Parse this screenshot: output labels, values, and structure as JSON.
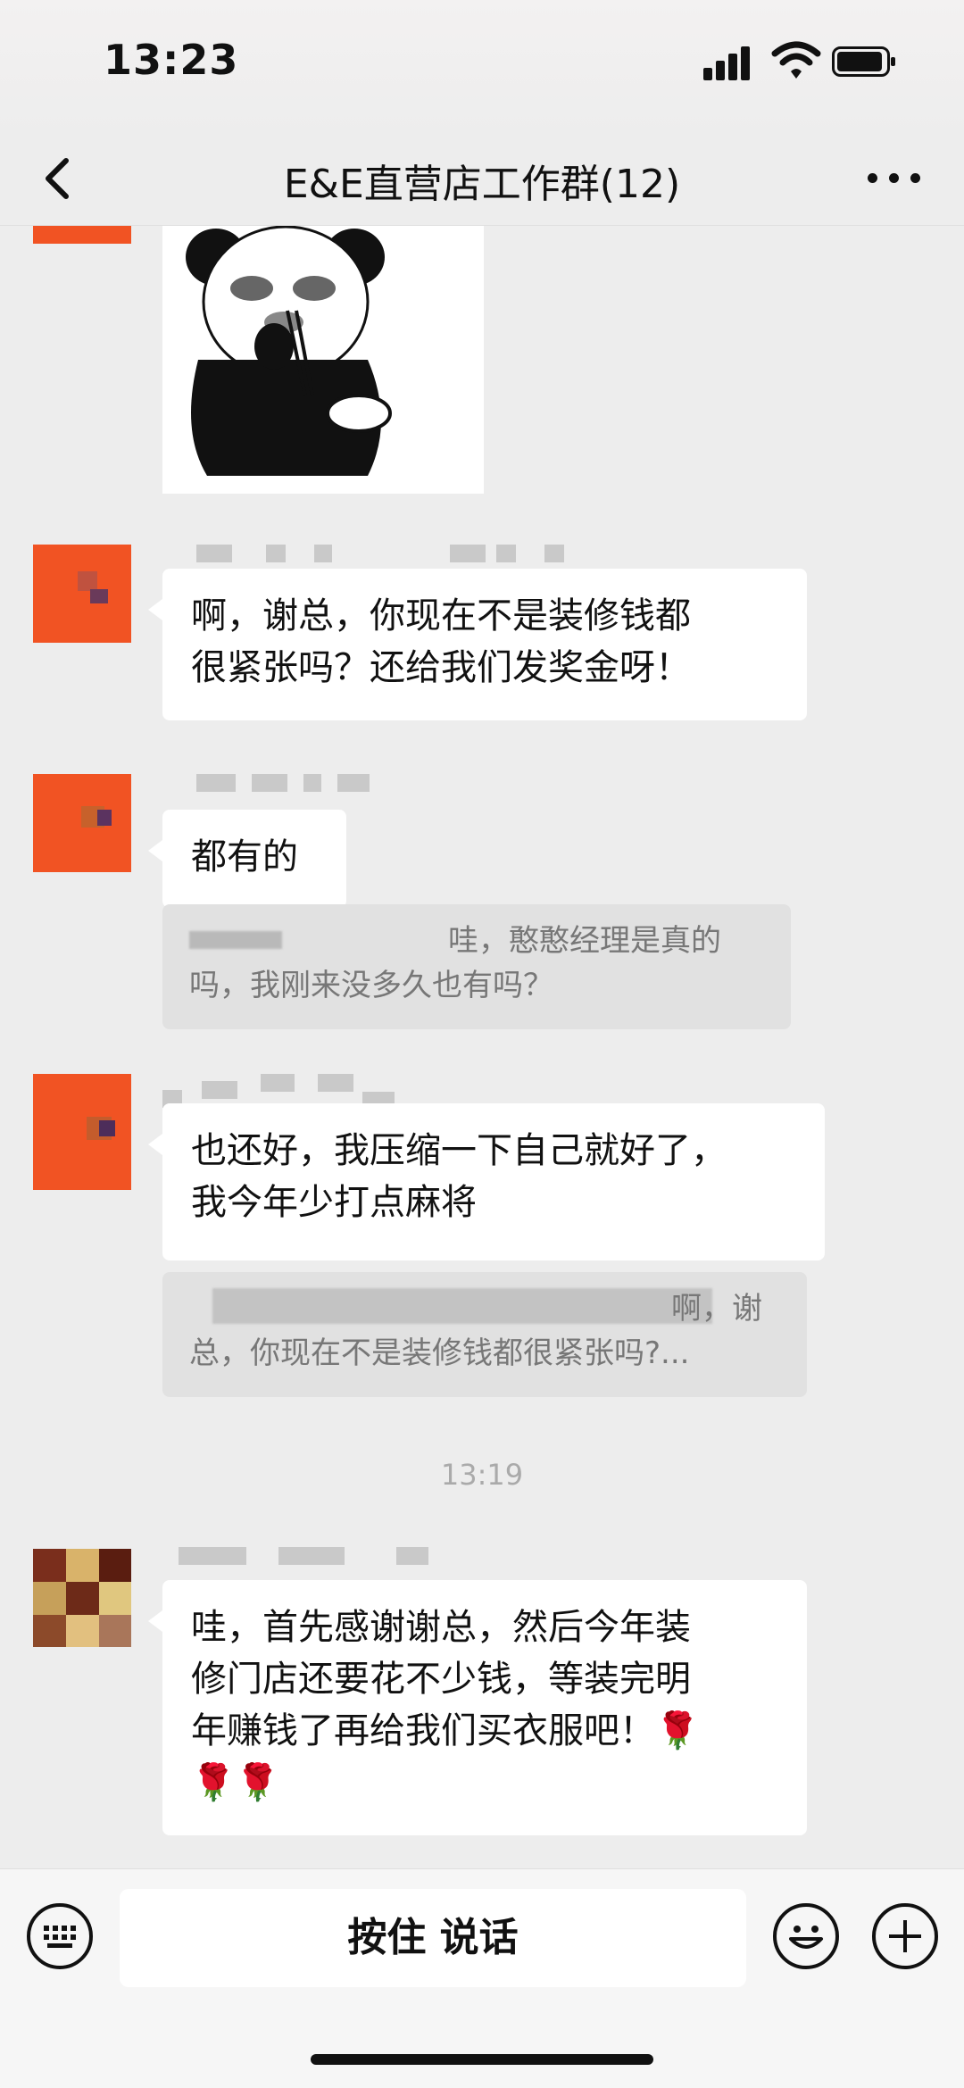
{
  "status": {
    "time": "13:23"
  },
  "nav": {
    "title": "E&E直营店工作群(12)"
  },
  "messages": [
    {
      "text": "啊，谢总，你现在不是装修钱都\n很紧张吗？还给我们发奖金呀！"
    },
    {
      "text": "都有的",
      "quote": "哇，憨憨经理是真的\n吗，我刚来没多久也有吗？"
    },
    {
      "text": "也还好，我压缩一下自己就好了，\n我今年少打点麻将",
      "quote": "啊，谢\n总，你现在不是装修钱都很紧张吗?..."
    },
    {
      "text": "哇，首先感谢谢总，然后今年装\n修门店还要花不少钱，等装完明\n年赚钱了再给我们买衣服吧！🌹\n🌹🌹"
    }
  ],
  "timestamp": "13:19",
  "input": {
    "hold_to_talk": "按住 说话"
  },
  "icons": [
    "back-icon",
    "more-icon",
    "keyboard-icon",
    "emoji-icon",
    "plus-icon",
    "signal-icon",
    "wifi-icon",
    "battery-icon"
  ]
}
